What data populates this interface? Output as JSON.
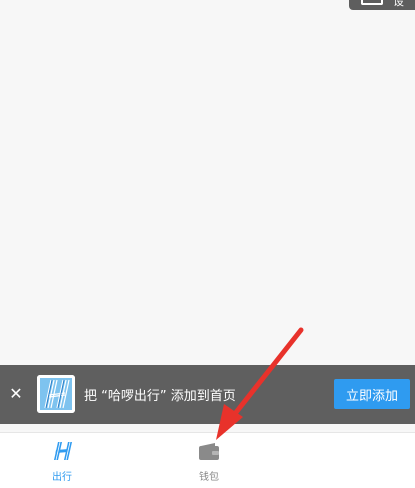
{
  "top_chip": {
    "label": "设",
    "icon": "menu-icon"
  },
  "banner": {
    "text": "把 “哈啰出行” 添加到首页",
    "button_label": "立即添加",
    "close_icon": "close-icon",
    "logo": "hello-logo-icon",
    "accent": "#2f9bf0"
  },
  "tabs": [
    {
      "label": "出行",
      "icon": "hello-h-icon",
      "active": true,
      "color": "#2f9bf0"
    },
    {
      "label": "钱包",
      "icon": "wallet-icon",
      "active": false,
      "color": "#8a8a8a"
    }
  ],
  "annotation": {
    "icon": "red-arrow-icon",
    "color": "#e8322b"
  }
}
